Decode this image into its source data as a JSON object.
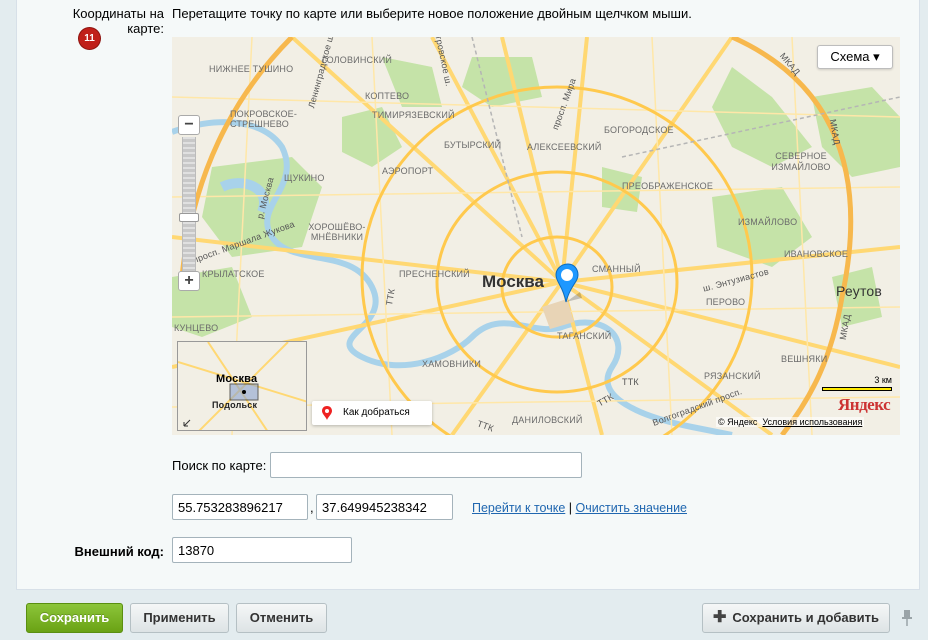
{
  "form": {
    "coords_label": "Координаты на карте:",
    "badge_count": "11",
    "hint": "Перетащите точку по карте или выберите новое положение двойным щелчком мыши.",
    "search_label": "Поиск по карте:",
    "search_value": "",
    "lat_value": "55.753283896217",
    "comma": ",",
    "lon_value": "37.649945238342",
    "link_goto": "Перейти к точке",
    "link_sep": "|",
    "link_clear": "Очистить значение",
    "ext_code_label": "Внешний код:",
    "ext_code_value": "13870"
  },
  "map": {
    "type_button": "Схема ▾",
    "city_label": "Москва",
    "reutov_label": "Реутов",
    "route_button": "Как добраться",
    "scale_label": "3 км",
    "logo": "Яндекс",
    "copyright": "© Яндекс",
    "terms_link": "Условия использования",
    "zoom_in": "+",
    "zoom_out": "−",
    "minimap_city": "Москва",
    "minimap_podolsk": "Подольск",
    "district_labels": [
      "ГОЛОВИНСКИЙ",
      "НИЖНЕЕ ТУШИНО",
      "КОПТЕВО",
      "ТИМИРЯЗЕВСКИЙ",
      "БУТЫРСКИЙ",
      "АЛЕКСЕЕВСКИЙ",
      "БОГОРОДСКОЕ",
      "ПОКРОВСКОЕ-СТРЕШНЕВО",
      "ЩУКИНО",
      "АЭРОПОРТ",
      "СЕВЕРНОЕ ИЗМАЙЛОВО",
      "ПРЕОБРАЖЕНСКОЕ",
      "ИЗМАЙЛОВО",
      "ХОРОШЁВО-МНЁВНИКИ",
      "ИВАНОВСКОЕ",
      "КРЫЛАТСКОЕ",
      "ПРЕСНЕНСКИЙ",
      "СМАННЫЙ",
      "ПЕРОВО",
      "КУНЦЕВО",
      "ХАМОВНИКИ",
      "ТАГАНСКИЙ",
      "РЯЗАНСКИЙ",
      "ВЕШНЯКИ",
      "ДАНИЛОВСКИЙ"
    ],
    "road_labels": [
      "МКАД",
      "МКАД",
      "МКАД",
      "ТТК",
      "ТТК",
      "ТТК",
      "ТТК",
      "просп. Мира",
      "р. Москва",
      "просп. Маршала Жукова",
      "ш. Энтузиастов",
      "Волгоградский просп.",
      "Ленинградское ш.",
      "Дмитровское ш."
    ]
  },
  "actions": {
    "save": "Сохранить",
    "apply": "Применить",
    "cancel": "Отменить",
    "save_add": "Сохранить и добавить"
  },
  "colors": {
    "save_green": "#7ab42a",
    "link_blue": "#2067b0",
    "badge_red": "#c0201a",
    "map_road": "#ffd873",
    "map_water": "#a8d2ea",
    "map_park": "#c5e3a8"
  }
}
